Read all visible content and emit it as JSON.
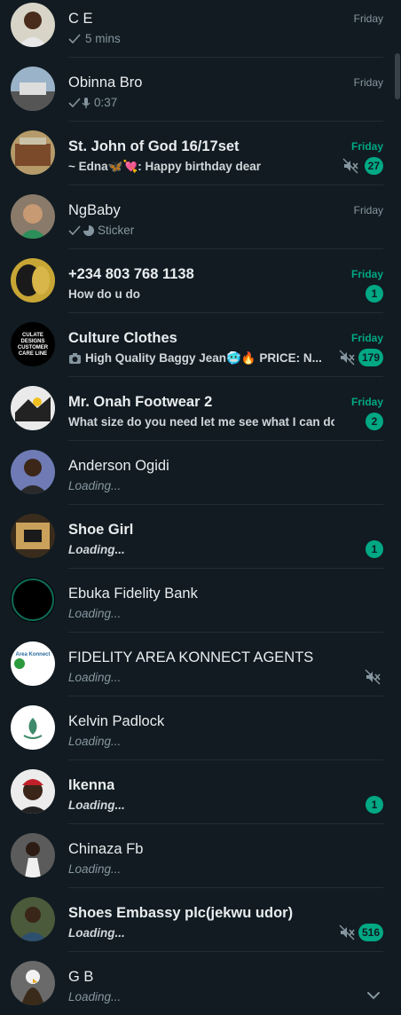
{
  "chats": [
    {
      "name": "C E",
      "time": "Friday",
      "preview": "5 mins",
      "preview_icon": "check-icon"
    },
    {
      "name": "Obinna Bro",
      "time": "Friday",
      "preview": "0:37",
      "preview_icon": "check-mic-icon"
    },
    {
      "name": "St. John of God 16/17set",
      "time": "Friday",
      "preview": "~ Edna🦋💘: Happy birthday dear",
      "muted": true,
      "badge": "27"
    },
    {
      "name": "NgBaby",
      "time": "Friday",
      "preview": "Sticker",
      "preview_icon": "check-sticker-icon"
    },
    {
      "name": "+234 803 768 1138",
      "time": "Friday",
      "preview": "How do u do",
      "badge": "1"
    },
    {
      "name": "Culture Clothes",
      "time": "Friday",
      "preview": "High Quality Baggy Jean🥶🔥 PRICE: N...",
      "preview_icon": "camera-icon",
      "muted": true,
      "badge": "179",
      "avatar_text": "CULATE DESIGNS CUSTOMER CARE LINE"
    },
    {
      "name": "Mr. Onah Footwear 2",
      "time": "Friday",
      "preview": "What size do you need let me see what I can do",
      "badge": "2"
    },
    {
      "name": "Anderson Ogidi",
      "time": "",
      "preview": "Loading..."
    },
    {
      "name": "Shoe Girl",
      "time": "",
      "preview": "Loading...",
      "badge": "1"
    },
    {
      "name": "Ebuka Fidelity Bank",
      "time": "",
      "preview": "Loading..."
    },
    {
      "name": "FIDELITY AREA KONNECT AGENTS",
      "time": "",
      "preview": "Loading...",
      "muted": true,
      "avatar_text": "Area Konnect"
    },
    {
      "name": "Kelvin Padlock",
      "time": "",
      "preview": "Loading..."
    },
    {
      "name": "Ikenna",
      "time": "",
      "preview": "Loading...",
      "badge": "1"
    },
    {
      "name": "Chinaza Fb",
      "time": "",
      "preview": "Loading..."
    },
    {
      "name": "Shoes Embassy plc(jekwu udor)",
      "time": "",
      "preview": "Loading...",
      "muted": true,
      "badge": "516"
    },
    {
      "name": "G B",
      "time": "",
      "preview": "Loading..."
    }
  ],
  "colors": {
    "background": "#111b21",
    "accent": "#00a884",
    "secondary_text": "#8696a0"
  },
  "scroll_down_icon": "chevron-down-icon"
}
